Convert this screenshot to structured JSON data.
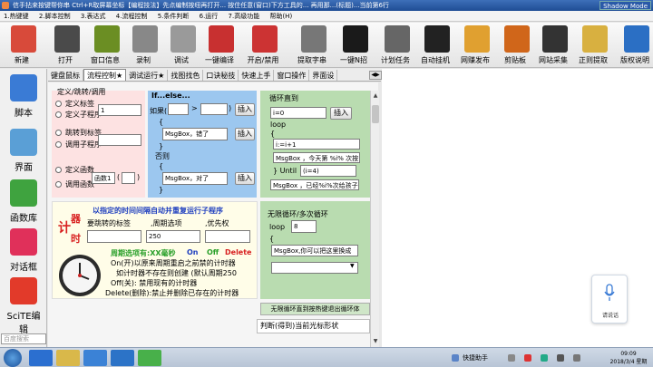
{
  "window": {
    "title": "信手拈来按键帮你串 Ctrl+R取屏幕坐标【编程技法】先点编制按纽再打开... 按住任意(窗口)下方工具的... 再用那...(标题)...当前第6行",
    "shadow_mode": "Shadow Mode"
  },
  "menu": {
    "items": [
      "1.热键键",
      "2.脚本控制",
      "3.表达式",
      "4.流程控制",
      "5.条件判断",
      "6.运行",
      "7.高级功能",
      "帮助(H)"
    ]
  },
  "toolbar": {
    "buttons": [
      {
        "label": "新建",
        "icon": "new-file-icon",
        "color": "#d84a3a"
      },
      {
        "label": "打开",
        "icon": "open-book-icon",
        "color": "#4a4a4a"
      },
      {
        "label": "窗口信息",
        "icon": "window-info-icon",
        "color": "#6b8e23"
      },
      {
        "label": "录制",
        "icon": "record-camera-icon",
        "color": "#888888"
      },
      {
        "label": "调试",
        "icon": "debug-gears-icon",
        "color": "#9a9a9a"
      },
      {
        "label": "一键编译",
        "icon": "compile-cup-icon",
        "color": "#c83030"
      },
      {
        "label": "开启/禁用",
        "icon": "toggle-panel-icon",
        "color": "#cc3333"
      },
      {
        "label": "提取字串",
        "icon": "pen-icon",
        "color": "#777777"
      },
      {
        "label": "一键N招",
        "icon": "game-disc-icon",
        "color": "#1a1a1a"
      },
      {
        "label": "计划任务",
        "icon": "schedule-clock-icon",
        "color": "#666666"
      },
      {
        "label": "自动挂机",
        "icon": "robot-icon",
        "color": "#222222"
      },
      {
        "label": "网赚发布",
        "icon": "puzzle-icon",
        "color": "#e0a030"
      },
      {
        "label": "剪贴板",
        "icon": "clipboard-icon",
        "color": "#d0661a"
      },
      {
        "label": "网站采集",
        "icon": "mouse-icon",
        "color": "#333333"
      },
      {
        "label": "正则提取",
        "icon": "regex-icon",
        "color": "#d8b040"
      },
      {
        "label": "版权说明",
        "icon": "accessibility-icon",
        "color": "#2b6fc4"
      }
    ]
  },
  "left_panel": {
    "buttons": [
      {
        "label": "脚本",
        "icon": "script-notebook-icon"
      },
      {
        "label": "界面",
        "icon": "ui-ruler-icon"
      },
      {
        "label": "函数库",
        "icon": "gift-box-icon"
      },
      {
        "label": "对话框",
        "icon": "dialog-icon"
      },
      {
        "label": "SciTE编辑",
        "icon": "scite-popcorn-icon"
      }
    ],
    "search_placeholder": "百度搜索"
  },
  "tabs": [
    "键盘鼠标",
    "流程控制★",
    "调试运行★",
    "找图找色",
    "口诀秘技",
    "快速上手",
    "窗口操作",
    "界面设"
  ],
  "labels_panel": {
    "heading": "定义/跳转/调用",
    "define_label": "定义标签",
    "define_sub": "定义子程序",
    "input_value": "1",
    "jump_label": "跳转到标签",
    "call_sub": "调用子程序",
    "define_func": "定义函数",
    "call_func": "调用函数",
    "func_label": "函数1",
    "paren_open": "(",
    "paren_close": ")"
  },
  "if_panel": {
    "heading": "If...else...",
    "if_label": "如果(",
    "op": ">",
    "close_paren": ")",
    "insert1": "插入",
    "brace_open": "{",
    "msg1": "MsgBox，错了",
    "insert2": "插入",
    "brace_close": "}",
    "else_label": "否则",
    "brace_open2": "{",
    "msg2": "MsgBox，对了",
    "insert3": "插入",
    "brace_close2": "}"
  },
  "loop_panel": {
    "heading": "循环直到",
    "init": "i=0",
    "insert": "插入",
    "loop_kw": "loop",
    "brace": "{",
    "incr": "i:=i+1",
    "msg": "MsgBox ，今天第 %i% 次按",
    "until_kw": "} Until",
    "until_cond": "(i=4)",
    "end_msg": "MsgBox ，已经%i%次给孩子0"
  },
  "timer_panel": {
    "heading": "以指定的时间间隔自动并重复运行子程序",
    "badge_top": "计",
    "badge_bottom": "时",
    "badge_side": "器",
    "label_target": "要跳转的标签",
    "label_period": ",周期选项",
    "label_priority": ",优先权",
    "period_value": "250",
    "period_hint": "周期选项有:XX毫秒",
    "on": "On",
    "off": "Off",
    "del": "Delete",
    "line1": "On(开)以原来周期重启之前禁的计时器",
    "line2": "如计时器不存在则创建 (默认周期250",
    "line3": "Off(关): 禁用现有的计时器",
    "line4": "Delete(删除):禁止并删除已存在的计时器"
  },
  "infinite_loop_panel": {
    "heading": "无限循环/多次循环",
    "loop_kw": "loop",
    "count": "8",
    "brace": "{",
    "msg": "MsgBox,你可以把这里换成",
    "select_value": ""
  },
  "bottom_bar": "无限循环直到按热键退出循环体",
  "status_text": "判断(得到)当前光标形状",
  "voice_widget": {
    "label": "请说话"
  },
  "taskbar": {
    "quick_label": "快捷助手",
    "time": "09:09",
    "date": "2018/3/4 星期日"
  }
}
